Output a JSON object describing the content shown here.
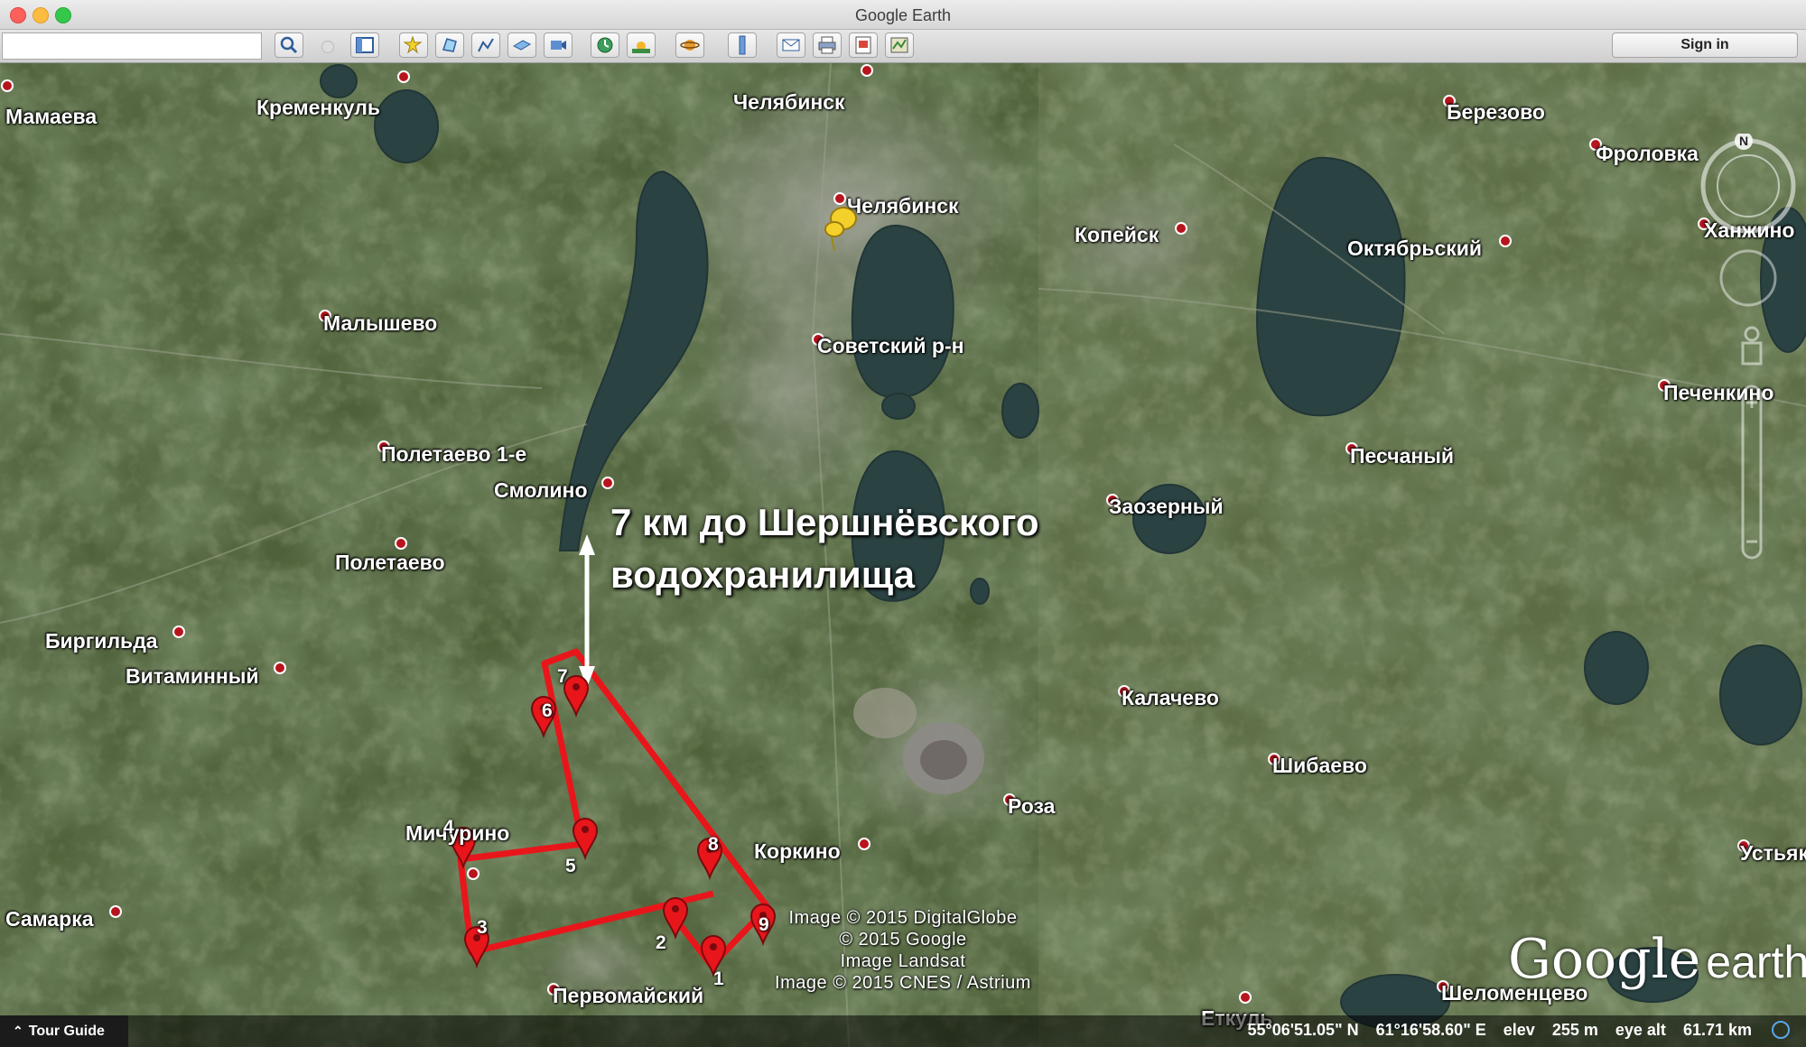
{
  "window": {
    "title": "Google Earth"
  },
  "toolbar": {
    "search_value": "",
    "sign_in": "Sign in",
    "buttons": [
      "search-icon",
      "sidebar-icon",
      "placemark-icon",
      "polygon-icon",
      "path-icon",
      "image-overlay-icon",
      "record-tour-icon",
      "historical-imagery-icon",
      "sunlight-icon",
      "planets-icon",
      "ruler-icon",
      "email-icon",
      "print-icon",
      "save-image-icon",
      "view-in-maps-icon"
    ]
  },
  "places": [
    {
      "name": "Мамаева"
    },
    {
      "name": "Кременкуль"
    },
    {
      "name": "Челябинск"
    },
    {
      "name": "Челябинск"
    },
    {
      "name": "Березово"
    },
    {
      "name": "Фроловка"
    },
    {
      "name": "Копейск"
    },
    {
      "name": "Октябрьский"
    },
    {
      "name": "Ханжино"
    },
    {
      "name": "Малышево"
    },
    {
      "name": "Советский р-н"
    },
    {
      "name": "Печенкино"
    },
    {
      "name": "Полетаево 1-е"
    },
    {
      "name": "Песчаный"
    },
    {
      "name": "Смолино"
    },
    {
      "name": "Заозерный"
    },
    {
      "name": "Полетаево"
    },
    {
      "name": "Биргильда"
    },
    {
      "name": "Витаминный"
    },
    {
      "name": "Калачево"
    },
    {
      "name": "Шибаево"
    },
    {
      "name": "Роза"
    },
    {
      "name": "Мичурино"
    },
    {
      "name": "Коркино"
    },
    {
      "name": "Устьяк"
    },
    {
      "name": "Самарка"
    },
    {
      "name": "Первомайский"
    },
    {
      "name": "Шеломенцево"
    },
    {
      "name": "Еткуль"
    }
  ],
  "waypoints": [
    "1",
    "2",
    "3",
    "4",
    "5",
    "6",
    "7",
    "8",
    "9"
  ],
  "annotation": {
    "line1": "7 км до Шершнёвского",
    "line2": "водохранилища"
  },
  "copyright": [
    "Image © 2015 DigitalGlobe",
    "© 2015 Google",
    "Image Landsat",
    "Image © 2015 CNES / Astrium"
  ],
  "logo": {
    "google": "Google",
    "earth": "earth"
  },
  "statusbar": {
    "tour_guide": "Tour Guide",
    "lat": "55°06'51.05\" N",
    "lon": "61°16'58.60\" E",
    "elev_label": "elev",
    "elev_value": "255 m",
    "eye_label": "eye alt",
    "eye_value": "61.71 km"
  },
  "compass": {
    "north": "N"
  },
  "colors": {
    "route": "#e8161b",
    "pin": "#e8161b",
    "place_dot": "#b8141d"
  }
}
